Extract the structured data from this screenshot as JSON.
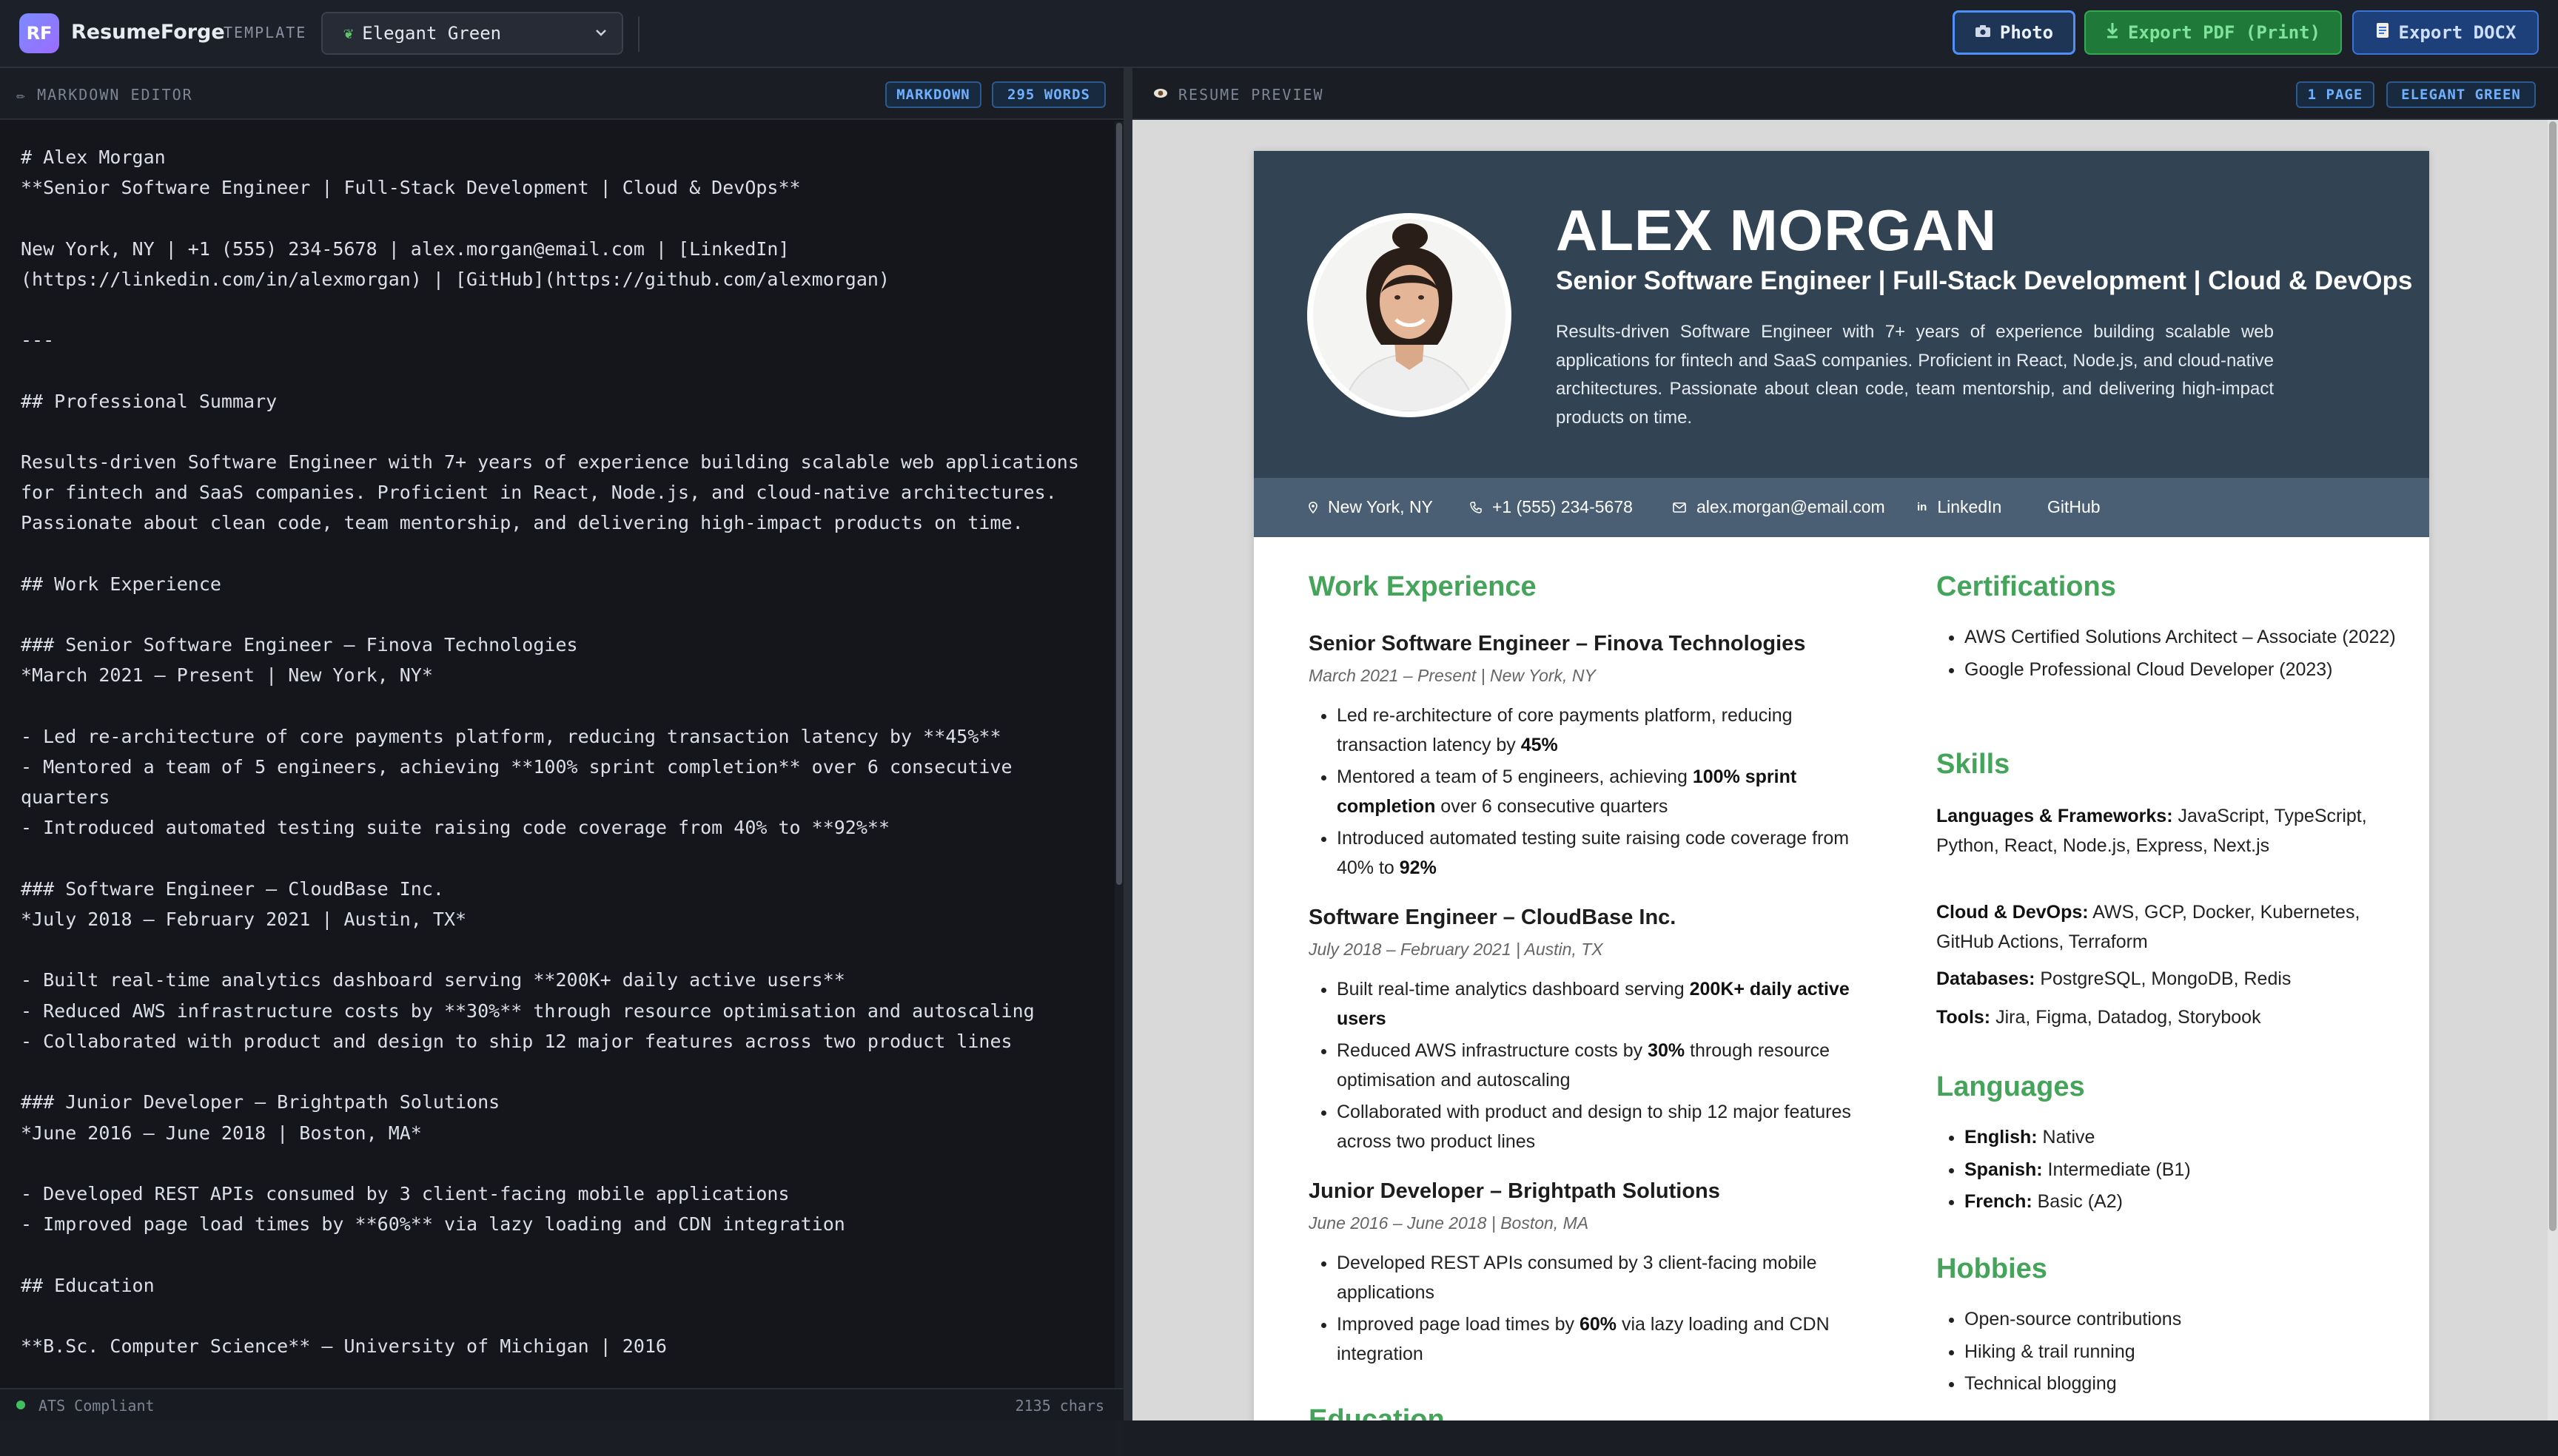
{
  "app": {
    "logo_text": "RF",
    "name": "ResumeForge",
    "template_label": "TEMPLATE",
    "template_value": "Elegant Green",
    "buttons": {
      "photo": "Photo",
      "pdf": "Export PDF (Print)",
      "docx": "Export DOCX"
    }
  },
  "editor": {
    "title": "✏ MARKDOWN EDITOR",
    "badge_mode": "MARKDOWN",
    "badge_words": "295 WORDS",
    "markdown": "# Alex Morgan\n**Senior Software Engineer | Full-Stack Development | Cloud & DevOps**\n\nNew York, NY | +1 (555) 234-5678 | alex.morgan@email.com | [LinkedIn]\n(https://linkedin.com/in/alexmorgan) | [GitHub](https://github.com/alexmorgan)\n\n---\n\n## Professional Summary\n\nResults-driven Software Engineer with 7+ years of experience building scalable web applications\nfor fintech and SaaS companies. Proficient in React, Node.js, and cloud-native architectures.\nPassionate about clean code, team mentorship, and delivering high-impact products on time.\n\n## Work Experience\n\n### Senior Software Engineer – Finova Technologies\n*March 2021 – Present | New York, NY*\n\n- Led re-architecture of core payments platform, reducing transaction latency by **45%**\n- Mentored a team of 5 engineers, achieving **100% sprint completion** over 6 consecutive\nquarters\n- Introduced automated testing suite raising code coverage from 40% to **92%**\n\n### Software Engineer – CloudBase Inc.\n*July 2018 – February 2021 | Austin, TX*\n\n- Built real-time analytics dashboard serving **200K+ daily active users**\n- Reduced AWS infrastructure costs by **30%** through resource optimisation and autoscaling\n- Collaborated with product and design to ship 12 major features across two product lines\n\n### Junior Developer – Brightpath Solutions\n*June 2016 – June 2018 | Boston, MA*\n\n- Developed REST APIs consumed by 3 client-facing mobile applications\n- Improved page load times by **60%** via lazy loading and CDN integration\n\n## Education\n\n**B.Sc. Computer Science** – University of Michigan | 2016",
    "status_ats": "ATS Compliant",
    "status_chars": "2135 chars"
  },
  "preview": {
    "title": "RESUME PREVIEW",
    "badge_pages": "1 PAGE",
    "badge_template": "ELEGANT GREEN",
    "name": "ALEX MORGAN",
    "headline": "Senior Software Engineer | Full-Stack Development | Cloud & DevOps",
    "summary": "Results-driven Software Engineer with 7+ years of experience building scalable web applications for fintech and SaaS companies. Proficient in React, Node.js, and cloud-native architectures. Passionate about clean code, team mentorship, and delivering high-impact products on time.",
    "contact": {
      "location": "New York, NY",
      "phone": "+1 (555) 234-5678",
      "email": "alex.morgan@email.com",
      "linkedin": "LinkedIn",
      "github": "GitHub"
    },
    "work_heading": "Work Experience",
    "jobs": [
      {
        "title": "Senior Software Engineer – Finova Technologies",
        "meta": "March 2021 – Present | New York, NY"
      },
      {
        "title": "Software Engineer – CloudBase Inc.",
        "meta": "July 2018 – February 2021 | Austin, TX"
      },
      {
        "title": "Junior Developer – Brightpath Solutions",
        "meta": "June 2016 – June 2018 | Boston, MA"
      }
    ],
    "bullets": {
      "j1b1_a": "Led re-architecture of core payments platform, reducing transaction latency by ",
      "j1b1_b": "45%",
      "j1b2_a": "Mentored a team of 5 engineers, achieving ",
      "j1b2_b": "100% sprint completion",
      "j1b2_c": " over 6 consecutive quarters",
      "j1b3_a": "Introduced automated testing suite raising code coverage from 40% to ",
      "j1b3_b": "92%",
      "j2b1_a": "Built real-time analytics dashboard serving ",
      "j2b1_b": "200K+ daily active users",
      "j2b2_a": "Reduced AWS infrastructure costs by ",
      "j2b2_b": "30%",
      "j2b2_c": " through resource optimisation and autoscaling",
      "j2b3": "Collaborated with product and design to ship 12 major features across two product lines",
      "j3b1": "Developed REST APIs consumed by 3 client-facing mobile applications",
      "j3b2_a": "Improved page load times by ",
      "j3b2_b": "60%",
      "j3b2_c": " via lazy loading and CDN integration"
    },
    "education_heading": "Education",
    "certifications_heading": "Certifications",
    "certifications": [
      "AWS Certified Solutions Architect – Associate (2022)",
      "Google Professional Cloud Developer (2023)"
    ],
    "skills_heading": "Skills",
    "skills": [
      {
        "label": "Languages & Frameworks:",
        "value": " JavaScript, TypeScript, Python, React, Node.js, Express, Next.js"
      },
      {
        "label": "Cloud & DevOps:",
        "value": " AWS, GCP, Docker, Kubernetes, GitHub Actions, Terraform"
      },
      {
        "label": "Databases:",
        "value": " PostgreSQL, MongoDB, Redis"
      },
      {
        "label": "Tools:",
        "value": " Jira, Figma, Datadog, Storybook"
      }
    ],
    "languages_heading": "Languages",
    "languages": [
      {
        "label": "English:",
        "value": " Native"
      },
      {
        "label": "Spanish:",
        "value": " Intermediate (B1)"
      },
      {
        "label": "French:",
        "value": " Basic (A2)"
      }
    ],
    "hobbies_heading": "Hobbies",
    "hobbies": [
      "Open-source contributions",
      "Hiking & trail running",
      "Technical blogging"
    ]
  },
  "colors": {
    "accent_green": "#43a45a",
    "header_slate": "#324354",
    "contact_bar": "#4a5f73",
    "badge_blue": "#6fb1ff"
  }
}
